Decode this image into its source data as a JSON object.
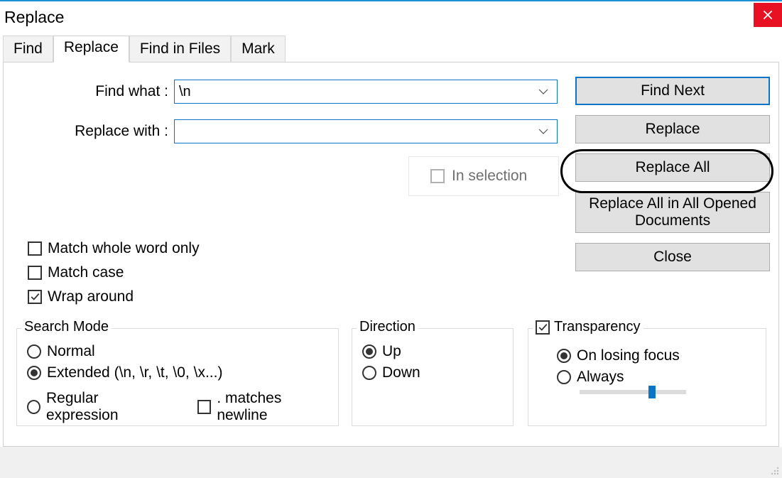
{
  "window": {
    "title": "Replace"
  },
  "tabs": {
    "find": "Find",
    "replace": "Replace",
    "find_in_files": "Find in Files",
    "mark": "Mark"
  },
  "form": {
    "find_label": "Find what :",
    "find_value": "\\n",
    "replace_label": "Replace with :",
    "replace_value": ""
  },
  "in_selection_label": "In selection",
  "buttons": {
    "find_next": "Find Next",
    "replace": "Replace",
    "replace_all": "Replace All",
    "replace_all_docs": "Replace All in All Opened Documents",
    "close": "Close"
  },
  "checks": {
    "match_word": "Match whole word only",
    "match_case": "Match case",
    "wrap": "Wrap around"
  },
  "search_mode": {
    "legend": "Search Mode",
    "normal": "Normal",
    "extended": "Extended (\\n, \\r, \\t, \\0, \\x...)",
    "regex": "Regular expression",
    "dot_matches": ". matches newline"
  },
  "direction": {
    "legend": "Direction",
    "up": "Up",
    "down": "Down"
  },
  "transparency": {
    "legend": "Transparency",
    "on_losing": "On losing focus",
    "always": "Always",
    "slider_pct": 68
  }
}
